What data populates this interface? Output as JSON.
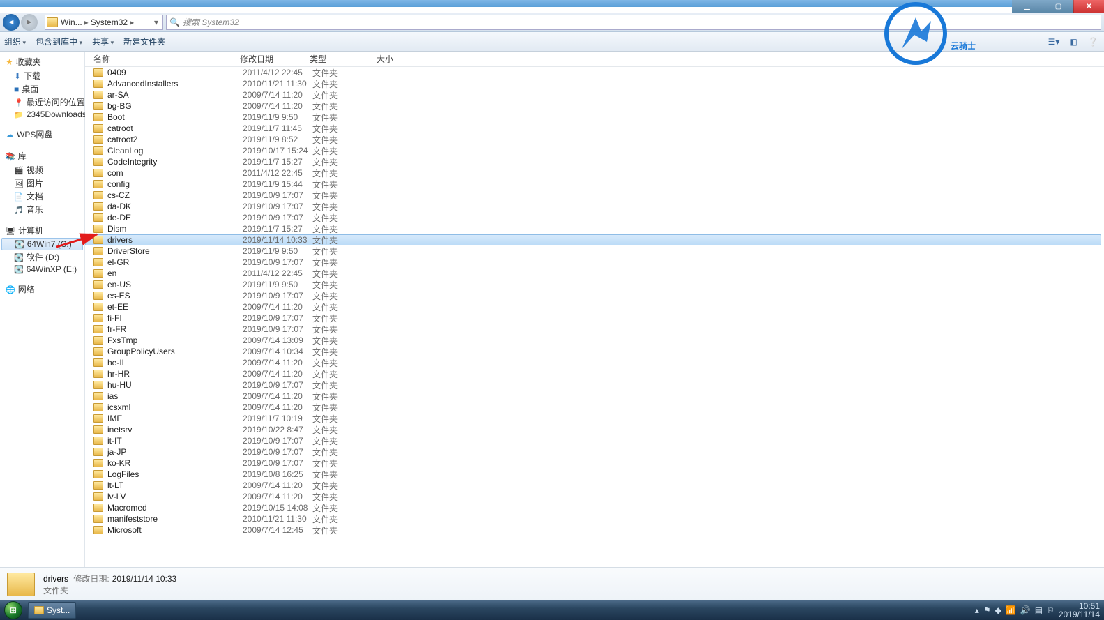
{
  "window": {
    "breadcrumb": [
      "Win...",
      "System32"
    ],
    "search_placeholder": "搜索 System32"
  },
  "toolbar": {
    "organize": "组织",
    "include": "包含到库中",
    "share": "共享",
    "newfolder": "新建文件夹"
  },
  "sidebar": {
    "favorites": {
      "label": "收藏夹",
      "items": [
        "下载",
        "桌面",
        "最近访问的位置",
        "2345Downloads"
      ]
    },
    "wps": "WPS网盘",
    "libraries": {
      "label": "库",
      "items": [
        "视频",
        "图片",
        "文档",
        "音乐"
      ]
    },
    "computer": {
      "label": "计算机",
      "items": [
        "64Win7  (C:)",
        "软件 (D:)",
        "64WinXP  (E:)"
      ],
      "selected": 0
    },
    "network": "网络"
  },
  "columns": {
    "name": "名称",
    "date": "修改日期",
    "type": "类型",
    "size": "大小"
  },
  "rows": [
    {
      "n": "0409",
      "d": "2011/4/12 22:45",
      "t": "文件夹"
    },
    {
      "n": "AdvancedInstallers",
      "d": "2010/11/21 11:30",
      "t": "文件夹"
    },
    {
      "n": "ar-SA",
      "d": "2009/7/14 11:20",
      "t": "文件夹"
    },
    {
      "n": "bg-BG",
      "d": "2009/7/14 11:20",
      "t": "文件夹"
    },
    {
      "n": "Boot",
      "d": "2019/11/9 9:50",
      "t": "文件夹"
    },
    {
      "n": "catroot",
      "d": "2019/11/7 11:45",
      "t": "文件夹"
    },
    {
      "n": "catroot2",
      "d": "2019/11/9 8:52",
      "t": "文件夹"
    },
    {
      "n": "CleanLog",
      "d": "2019/10/17 15:24",
      "t": "文件夹"
    },
    {
      "n": "CodeIntegrity",
      "d": "2019/11/7 15:27",
      "t": "文件夹"
    },
    {
      "n": "com",
      "d": "2011/4/12 22:45",
      "t": "文件夹"
    },
    {
      "n": "config",
      "d": "2019/11/9 15:44",
      "t": "文件夹"
    },
    {
      "n": "cs-CZ",
      "d": "2019/10/9 17:07",
      "t": "文件夹"
    },
    {
      "n": "da-DK",
      "d": "2019/10/9 17:07",
      "t": "文件夹"
    },
    {
      "n": "de-DE",
      "d": "2019/10/9 17:07",
      "t": "文件夹"
    },
    {
      "n": "Dism",
      "d": "2019/11/7 15:27",
      "t": "文件夹"
    },
    {
      "n": "drivers",
      "d": "2019/11/14 10:33",
      "t": "文件夹",
      "sel": true
    },
    {
      "n": "DriverStore",
      "d": "2019/11/9 9:50",
      "t": "文件夹"
    },
    {
      "n": "el-GR",
      "d": "2019/10/9 17:07",
      "t": "文件夹"
    },
    {
      "n": "en",
      "d": "2011/4/12 22:45",
      "t": "文件夹"
    },
    {
      "n": "en-US",
      "d": "2019/11/9 9:50",
      "t": "文件夹"
    },
    {
      "n": "es-ES",
      "d": "2019/10/9 17:07",
      "t": "文件夹"
    },
    {
      "n": "et-EE",
      "d": "2009/7/14 11:20",
      "t": "文件夹"
    },
    {
      "n": "fi-FI",
      "d": "2019/10/9 17:07",
      "t": "文件夹"
    },
    {
      "n": "fr-FR",
      "d": "2019/10/9 17:07",
      "t": "文件夹"
    },
    {
      "n": "FxsTmp",
      "d": "2009/7/14 13:09",
      "t": "文件夹"
    },
    {
      "n": "GroupPolicyUsers",
      "d": "2009/7/14 10:34",
      "t": "文件夹"
    },
    {
      "n": "he-IL",
      "d": "2009/7/14 11:20",
      "t": "文件夹"
    },
    {
      "n": "hr-HR",
      "d": "2009/7/14 11:20",
      "t": "文件夹"
    },
    {
      "n": "hu-HU",
      "d": "2019/10/9 17:07",
      "t": "文件夹"
    },
    {
      "n": "ias",
      "d": "2009/7/14 11:20",
      "t": "文件夹"
    },
    {
      "n": "icsxml",
      "d": "2009/7/14 11:20",
      "t": "文件夹"
    },
    {
      "n": "IME",
      "d": "2019/11/7 10:19",
      "t": "文件夹"
    },
    {
      "n": "inetsrv",
      "d": "2019/10/22 8:47",
      "t": "文件夹"
    },
    {
      "n": "it-IT",
      "d": "2019/10/9 17:07",
      "t": "文件夹"
    },
    {
      "n": "ja-JP",
      "d": "2019/10/9 17:07",
      "t": "文件夹"
    },
    {
      "n": "ko-KR",
      "d": "2019/10/9 17:07",
      "t": "文件夹"
    },
    {
      "n": "LogFiles",
      "d": "2019/10/8 16:25",
      "t": "文件夹"
    },
    {
      "n": "lt-LT",
      "d": "2009/7/14 11:20",
      "t": "文件夹"
    },
    {
      "n": "lv-LV",
      "d": "2009/7/14 11:20",
      "t": "文件夹"
    },
    {
      "n": "Macromed",
      "d": "2019/10/15 14:08",
      "t": "文件夹"
    },
    {
      "n": "manifeststore",
      "d": "2010/11/21 11:30",
      "t": "文件夹"
    },
    {
      "n": "Microsoft",
      "d": "2009/7/14 12:45",
      "t": "文件夹"
    }
  ],
  "details": {
    "name": "drivers",
    "date_label": "修改日期:",
    "date": "2019/11/14 10:33",
    "type": "文件夹"
  },
  "taskbar": {
    "app": "Syst..."
  },
  "tray": {
    "time": "10:51",
    "date": "2019/11/14"
  },
  "watermark": "云骑士"
}
